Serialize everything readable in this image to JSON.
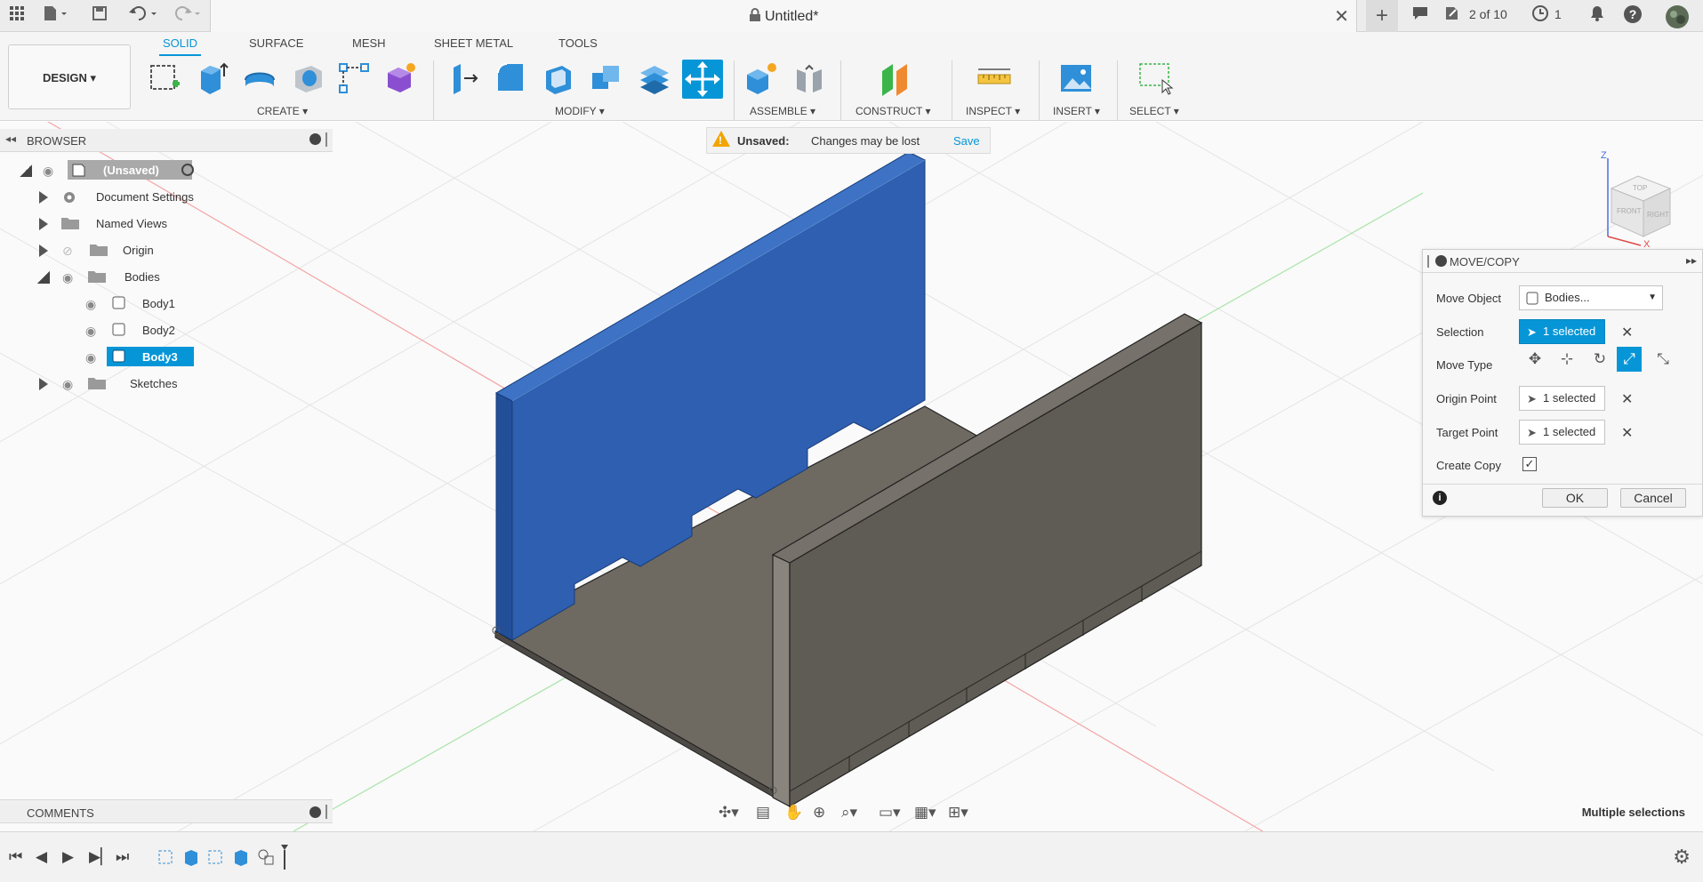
{
  "title": {
    "doc_title": "Untitled*",
    "job_status": "2 of 10",
    "clock_count": "1"
  },
  "workspace": {
    "label": "DESIGN"
  },
  "tabs": [
    "SOLID",
    "SURFACE",
    "MESH",
    "SHEET METAL",
    "TOOLS"
  ],
  "active_tab": "SOLID",
  "groups": {
    "create": "CREATE",
    "modify": "MODIFY",
    "assemble": "ASSEMBLE",
    "construct": "CONSTRUCT",
    "inspect": "INSPECT",
    "insert": "INSERT",
    "select": "SELECT"
  },
  "banner": {
    "label": "Unsaved:",
    "message": "Changes may be lost",
    "save": "Save"
  },
  "browser": {
    "title": "BROWSER",
    "root": "(Unsaved)",
    "items": [
      "Document Settings",
      "Named Views",
      "Origin",
      "Bodies"
    ],
    "bodies": [
      "Body1",
      "Body2",
      "Body3"
    ],
    "sketches": "Sketches"
  },
  "movecopy": {
    "title": "MOVE/COPY",
    "move_object_label": "Move Object",
    "move_object_value": "Bodies...",
    "selection_label": "Selection",
    "selection_value": "1 selected",
    "move_type_label": "Move Type",
    "origin_label": "Origin Point",
    "origin_value": "1 selected",
    "target_label": "Target Point",
    "target_value": "1 selected",
    "copy_label": "Create Copy",
    "ok": "OK",
    "cancel": "Cancel"
  },
  "comments": {
    "title": "COMMENTS"
  },
  "status": {
    "text": "Multiple selections"
  },
  "colors": {
    "accent": "#0696d7",
    "selected_body": "#2e5fb0",
    "body": "#6e6a62"
  }
}
